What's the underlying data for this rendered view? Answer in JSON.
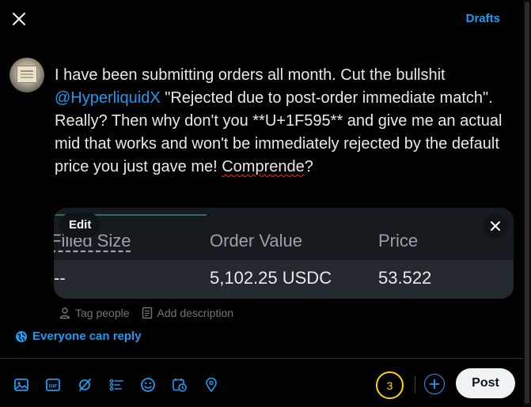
{
  "header": {
    "drafts_label": "Drafts"
  },
  "tweet": {
    "text_before_mention": "I have been submitting orders all month. Cut the bullshit ",
    "mention": "@HyperliquidX",
    "text_after_mention": " \"Rejected due to post-order immediate match\". Really? Then why don't you **U+1F595** and give me an actual mid that works and won't be immediately rejected by the default price you just gave me! ",
    "misspelled_word": "Comprende",
    "trailing": "?"
  },
  "media": {
    "edit_label": "Edit",
    "columns": [
      "Filled Size",
      "Order Value",
      "Price"
    ],
    "values": [
      "--",
      "5,102.25 USDC",
      "53.522"
    ]
  },
  "media_actions": {
    "tag_people": "Tag people",
    "add_description": "Add description"
  },
  "reply_setting": "Everyone can reply",
  "composer": {
    "char_counter": "3",
    "post_label": "Post"
  },
  "colors": {
    "accent": "#1d9bf0",
    "counter": "#ffd400",
    "background": "#000000"
  },
  "icons": [
    "close-icon",
    "image-icon",
    "gif-icon",
    "grok-icon",
    "poll-icon",
    "emoji-icon",
    "schedule-icon",
    "location-icon",
    "plus-icon",
    "person-icon",
    "alt-text-icon",
    "globe-icon"
  ]
}
